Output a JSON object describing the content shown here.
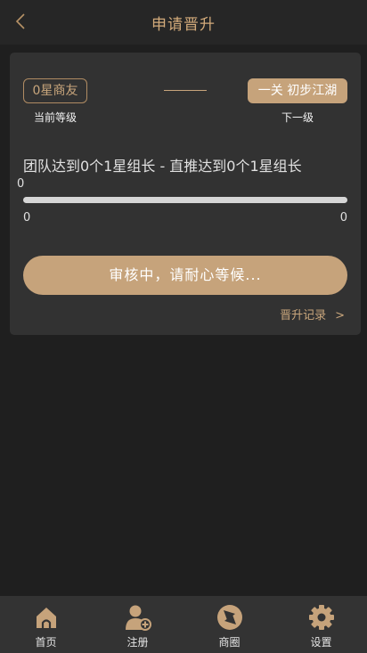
{
  "header": {
    "title": "申请晋升",
    "back_icon": "chevron-left-icon"
  },
  "levels": {
    "current_badge": "0星商友",
    "current_caption": "当前等级",
    "next_badge": "一关 初步江湖",
    "next_caption": "下一级"
  },
  "progress": {
    "task_text": "团队达到0个1星组长 - 直推达到0个1星组长",
    "current_value": "0",
    "min_label": "0",
    "max_label": "0",
    "fill_fraction": 0
  },
  "status_button": {
    "label": "审核中，请耐心等候..."
  },
  "record_link": {
    "label": "晋升记录",
    "chevron": ">"
  },
  "tabbar": {
    "items": [
      {
        "label": "首页",
        "icon": "home-icon"
      },
      {
        "label": "注册",
        "icon": "add-user-icon"
      },
      {
        "label": "商圈",
        "icon": "shutter-icon"
      },
      {
        "label": "设置",
        "icon": "gear-icon"
      }
    ]
  },
  "colors": {
    "accent": "#c6a37b",
    "background": "#1f1f1f",
    "card": "#323232",
    "header": "#262626",
    "tabbar": "#333333",
    "track": "#d6d6d6"
  }
}
